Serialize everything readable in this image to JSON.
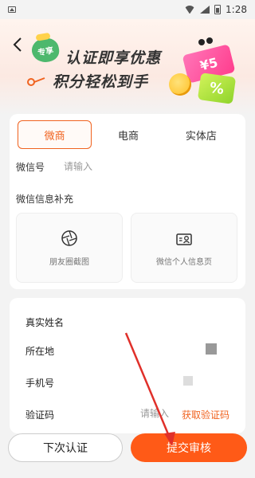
{
  "status_bar": {
    "time": "1:28"
  },
  "banner": {
    "badge_text": "专享",
    "title_line1": "认证即享优惠",
    "title_line2": "积分轻松到手",
    "ticket_text": "¥5",
    "percent_text": "%"
  },
  "tabs": [
    {
      "label": "微商",
      "active": true
    },
    {
      "label": "电商",
      "active": false
    },
    {
      "label": "实体店",
      "active": false
    }
  ],
  "wechat": {
    "label": "微信号",
    "placeholder": "请输入"
  },
  "supplement": {
    "title": "微信信息补充",
    "upload_moments": "朋友圈截图",
    "upload_profile": "微信个人信息页"
  },
  "form": {
    "name_label": "真实姓名",
    "location_label": "所在地",
    "phone_label": "手机号",
    "code_label": "验证码",
    "code_placeholder": "请输入",
    "get_code_label": "获取验证码"
  },
  "buttons": {
    "later_label": "下次认证",
    "submit_label": "提交审核"
  },
  "colors": {
    "accent": "#f06320",
    "submit": "#ff5a17",
    "annotation": "#e0302a"
  }
}
